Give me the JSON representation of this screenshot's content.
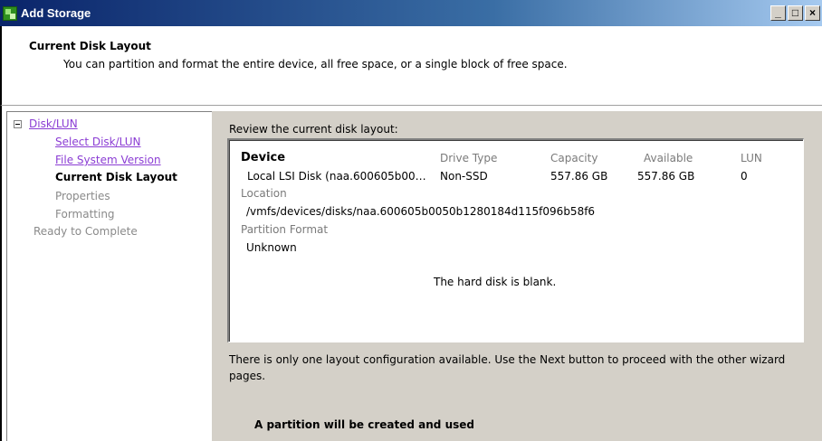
{
  "window": {
    "title": "Add Storage",
    "controls": {
      "minimize": "_",
      "maximize": "□",
      "close": "×"
    }
  },
  "header": {
    "title": "Current Disk Layout",
    "description": "You can partition and format the entire device, all free space, or a single block of free space."
  },
  "nav": {
    "root": {
      "label": "Disk/LUN",
      "expander": "minus"
    },
    "items": [
      {
        "label": "Select Disk/LUN",
        "state": "link"
      },
      {
        "label": "File System Version",
        "state": "link"
      },
      {
        "label": "Current Disk Layout",
        "state": "current"
      },
      {
        "label": "Properties",
        "state": "disabled"
      },
      {
        "label": "Formatting",
        "state": "disabled"
      },
      {
        "label": "Ready to Complete",
        "state": "disabled"
      }
    ]
  },
  "main": {
    "review_label": "Review the current disk layout:",
    "columns": {
      "device": "Device",
      "drive_type": "Drive Type",
      "capacity": "Capacity",
      "available": "Available",
      "lun": "LUN"
    },
    "row": {
      "device": "Local LSI Disk (naa.600605b00…",
      "drive_type": "Non-SSD",
      "capacity": "557.86 GB",
      "available": "557.86 GB",
      "lun": "0"
    },
    "location_label": "Location",
    "location_value": "/vmfs/devices/disks/naa.600605b0050b1280184d115f096b58f6",
    "partition_format_label": "Partition Format",
    "partition_format_value": "Unknown",
    "blank_message": "The hard disk is blank.",
    "info_text": "There is only one layout configuration available. Use the Next button to proceed with the other wizard pages.",
    "partition_note": "A partition will be created and used"
  },
  "colors": {
    "titlebar_start": "#0a246a",
    "titlebar_end": "#a6caf0",
    "link": "#8b3dd4",
    "disabled_text": "#8a8a8a",
    "panel_bg": "#d4d0c8"
  }
}
